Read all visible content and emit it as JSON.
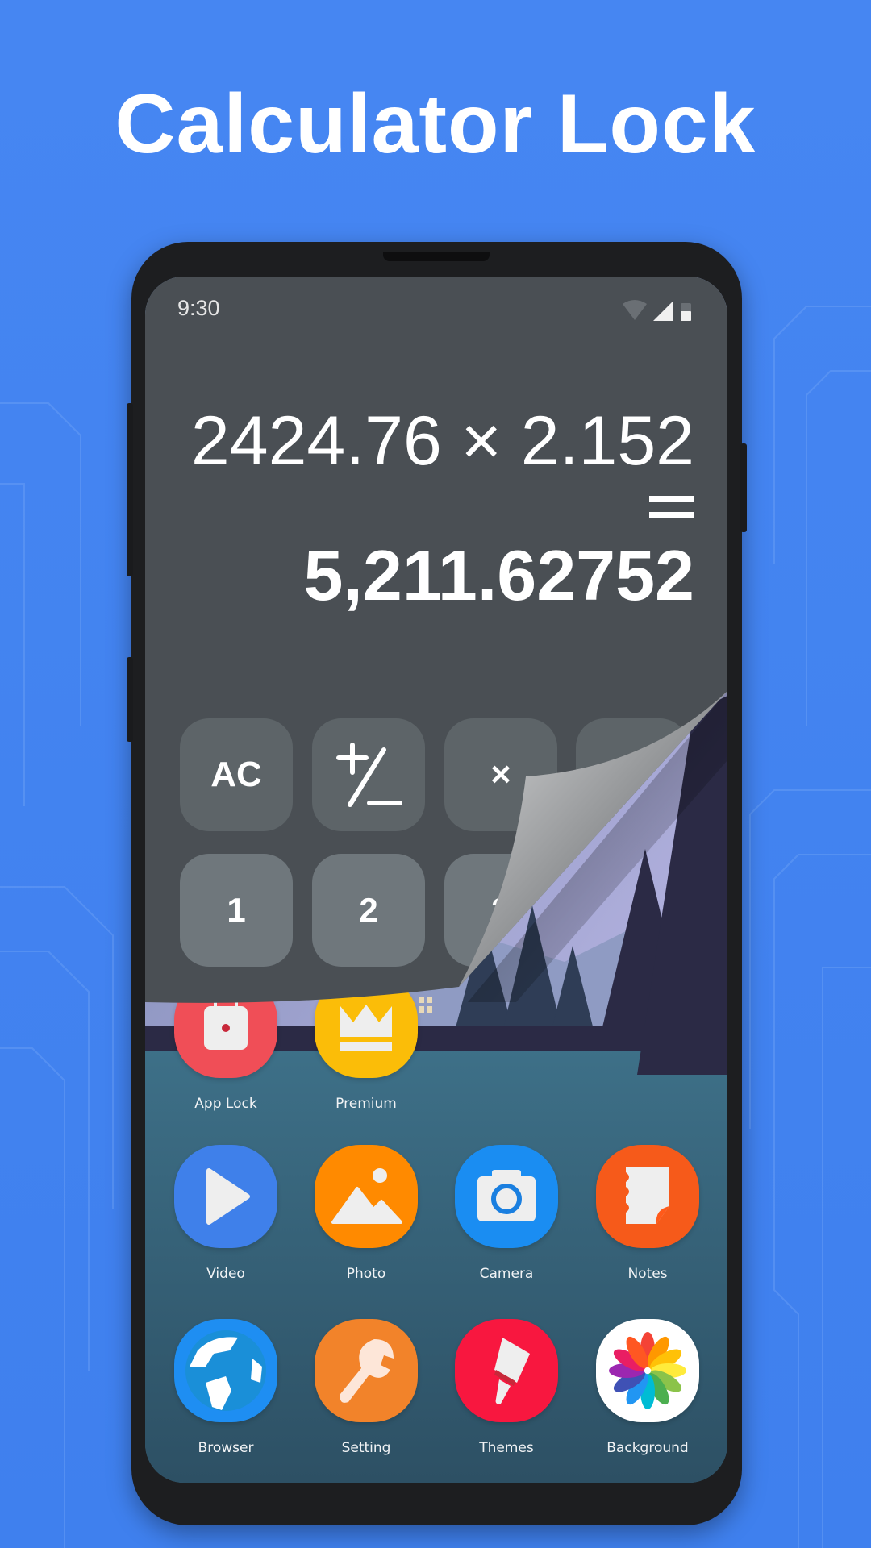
{
  "headline": "Calculator Lock",
  "status_bar": {
    "time": "9:30",
    "icons": [
      "wifi-icon",
      "signal-icon",
      "battery-icon"
    ]
  },
  "calculator": {
    "expression": "2424.76 × 2.152",
    "equals": "=",
    "result": "5,211.62752",
    "keys_row1": [
      "AC",
      "+/-",
      "×",
      "÷"
    ],
    "keys_row2": [
      "1",
      "2",
      "3"
    ]
  },
  "home_apps": [
    {
      "label": "App Lock",
      "icon": "app-lock-icon",
      "color": "#f04e57"
    },
    {
      "label": "Premium",
      "icon": "crown-icon",
      "color": "#fbbd08"
    },
    {
      "label": "Video",
      "icon": "play-icon",
      "color": "#3f80ea"
    },
    {
      "label": "Photo",
      "icon": "image-icon",
      "color": "#ff8a00"
    },
    {
      "label": "Camera",
      "icon": "camera-icon",
      "color": "#1a8df2"
    },
    {
      "label": "Notes",
      "icon": "notes-icon",
      "color": "#f65a1a"
    },
    {
      "label": "Browser",
      "icon": "globe-icon",
      "color": "#1e8ef2"
    },
    {
      "label": "Setting",
      "icon": "wrench-icon",
      "color": "#f2832a"
    },
    {
      "label": "Themes",
      "icon": "paintbrush-icon",
      "color": "#f8173f"
    },
    {
      "label": "Background",
      "icon": "color-wheel-icon",
      "color": "#ffffff"
    }
  ],
  "colors": {
    "background": "#4285f0",
    "calculator_bg": "#4a4f54",
    "lake": "#3b6a80"
  }
}
